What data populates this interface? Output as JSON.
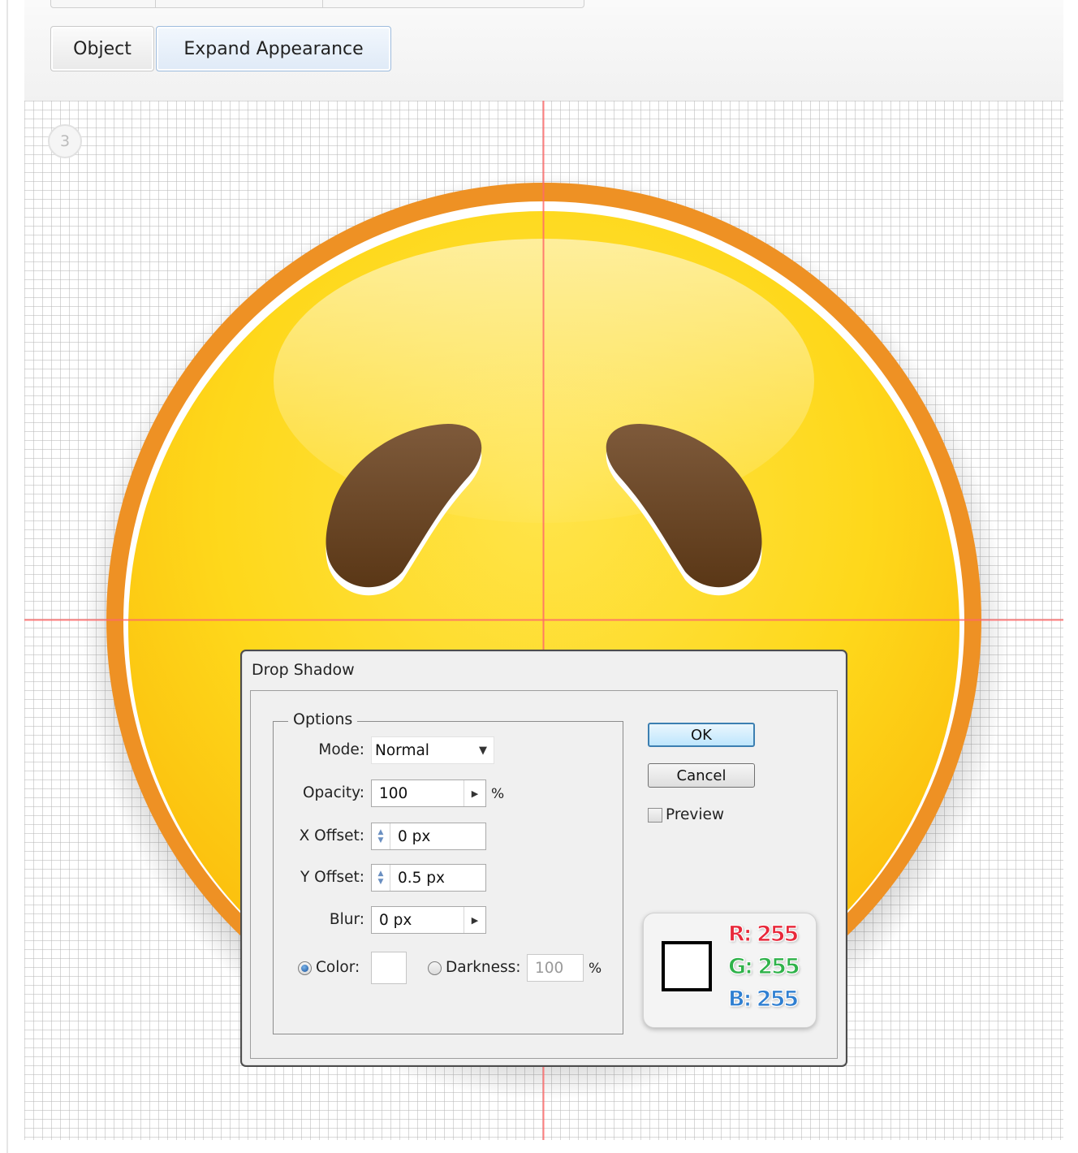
{
  "menu": {
    "path": [
      {
        "label": "Object",
        "active": false
      },
      {
        "label": "Expand Appearance",
        "active": true
      }
    ]
  },
  "step_number": "3",
  "dialog": {
    "title": "Drop Shadow",
    "options_legend": "Options",
    "mode": {
      "label": "Mode:",
      "value": "Normal"
    },
    "opacity": {
      "label": "Opacity:",
      "value": "100",
      "unit": "%"
    },
    "x_offset": {
      "label": "X Offset:",
      "value": "0 px"
    },
    "y_offset": {
      "label": "Y Offset:",
      "value": "0.5 px"
    },
    "blur": {
      "label": "Blur:",
      "value": "0 px"
    },
    "color": {
      "label": "Color:",
      "selected": true,
      "swatch": "#ffffff"
    },
    "darkness": {
      "label": "Darkness:",
      "value": "100",
      "unit": "%",
      "selected": false
    },
    "buttons": {
      "ok": "OK",
      "cancel": "Cancel"
    },
    "preview": {
      "label": "Preview",
      "checked": false
    }
  },
  "color_callout": {
    "swatch": "#ffffff",
    "r": "R: 255",
    "g": "G: 255",
    "b": "B: 255",
    "colors": {
      "r": "#e8283a",
      "g": "#2fb24a",
      "b": "#2f7fd1"
    }
  },
  "colors": {
    "guide": "#ff6a6a",
    "face_rim": "#ee9124",
    "face_fill_top": "#ffe680",
    "face_fill_bottom": "#fdd20c",
    "eye": "#6b4527"
  }
}
